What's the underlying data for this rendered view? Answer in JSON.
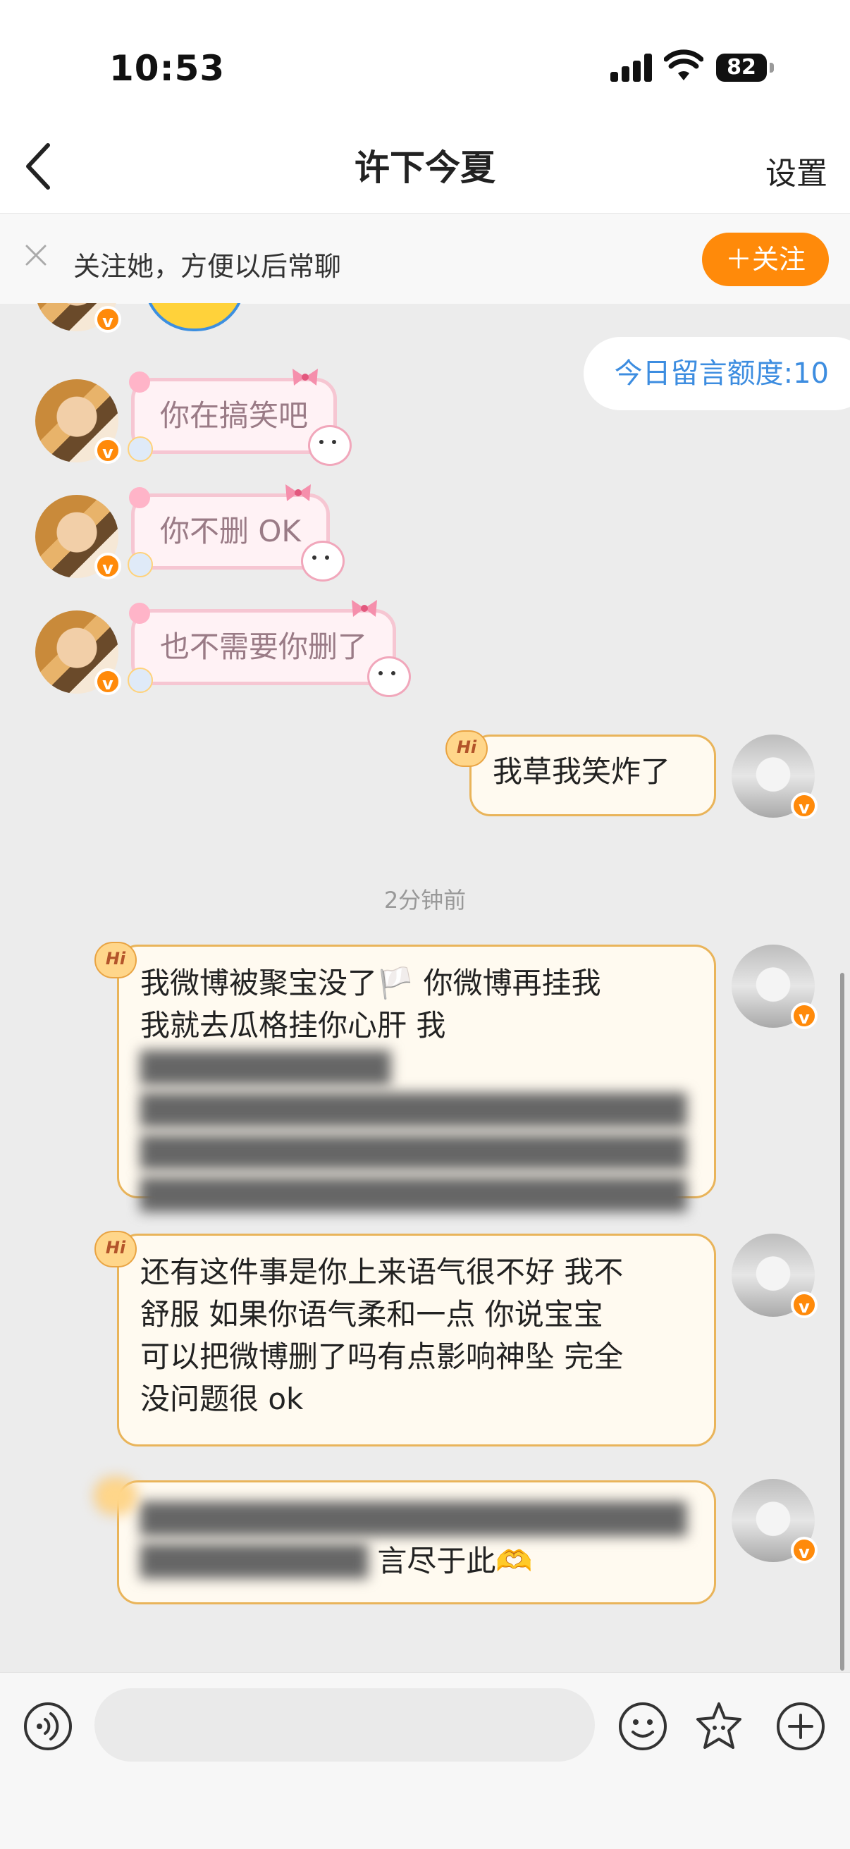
{
  "status": {
    "time": "10:53",
    "battery": "82"
  },
  "nav": {
    "title": "许下今夏",
    "settings": "设置"
  },
  "banner": {
    "text": "关注她，方便以后常聊",
    "follow": "＋关注"
  },
  "chat": {
    "quota": "今日留言额度:10",
    "timestamp": "2分钟前",
    "badge_hi": "Hi",
    "verified_mark": "v",
    "received": [
      "你在搞笑吧",
      "你不删 OK",
      "也不需要你删了"
    ],
    "sent_short": "我草我笑炸了",
    "sent_long1_visible": [
      "我微博被聚宝没了🏳️ 你微博再挂我",
      "我就去瓜格挂你心肝 我"
    ],
    "sent_long2": [
      "还有这件事是你上来语气很不好 我不",
      "舒服 如果你语气柔和一点 你说宝宝",
      "可以把微博删了吗有点影响神坠 完全",
      "没问题很 ok"
    ],
    "sent_long3_visible": "言尽于此🫶"
  },
  "input": {
    "placeholder": ""
  },
  "icons": [
    "back-icon",
    "close-icon",
    "voice-icon",
    "emoji-icon",
    "sticker-icon",
    "add-icon"
  ]
}
